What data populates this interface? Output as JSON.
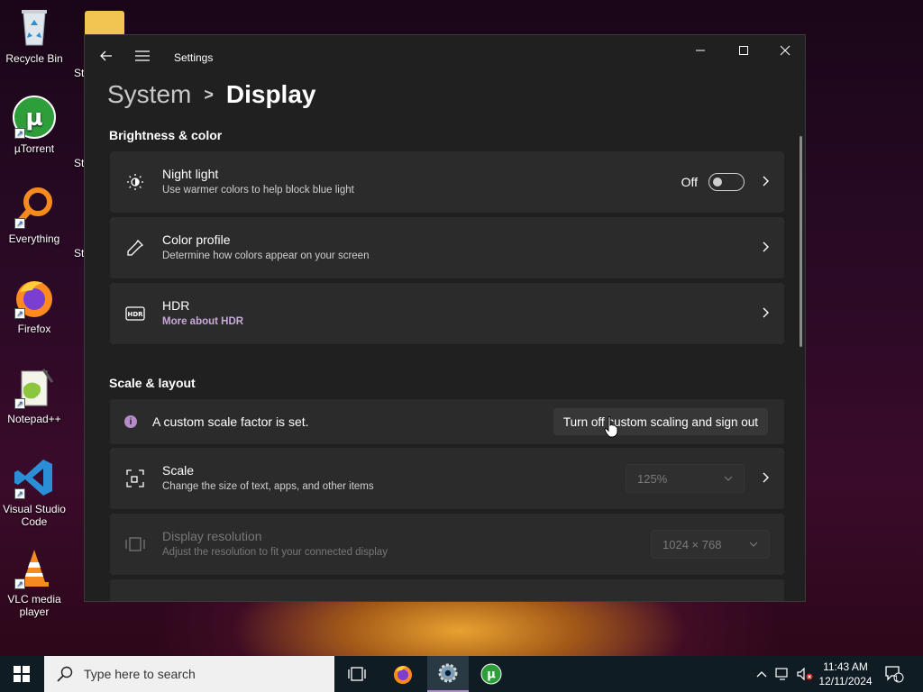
{
  "desktop": {
    "icons": [
      {
        "label": "Recycle Bin"
      },
      {
        "label": "µTorrent"
      },
      {
        "label": "Everything"
      },
      {
        "label": "Firefox"
      },
      {
        "label": "Notepad++"
      },
      {
        "label": "Visual Studio Code"
      },
      {
        "label": "VLC media player"
      }
    ],
    "partial_labels": [
      "St",
      "St",
      "St"
    ]
  },
  "window": {
    "title": "Settings",
    "breadcrumb": {
      "parent": "System",
      "separator": ">",
      "current": "Display"
    },
    "sections": {
      "brightness": "Brightness & color",
      "scale": "Scale & layout"
    },
    "night_light": {
      "title": "Night light",
      "subtitle": "Use warmer colors to help block blue light",
      "state_label": "Off",
      "enabled": false
    },
    "color_profile": {
      "title": "Color profile",
      "subtitle": "Determine how colors appear on your screen"
    },
    "hdr": {
      "title": "HDR",
      "link": "More about HDR"
    },
    "custom_scale": {
      "message": "A custom scale factor is set.",
      "button": "Turn off custom scaling and sign out"
    },
    "scale": {
      "title": "Scale",
      "subtitle": "Change the size of text, apps, and other items",
      "value": "125%"
    },
    "resolution": {
      "title": "Display resolution",
      "subtitle": "Adjust the resolution to fit your connected display",
      "value": "1024 × 768"
    }
  },
  "taskbar": {
    "search_placeholder": "Type here to search",
    "time": "11:43 AM",
    "date": "12/11/2024",
    "notification_count": "1"
  },
  "colors": {
    "accent": "#b58bc9",
    "window_bg": "#202020",
    "card_bg": "#2b2b2b",
    "taskbar_bg": "#101c24"
  }
}
